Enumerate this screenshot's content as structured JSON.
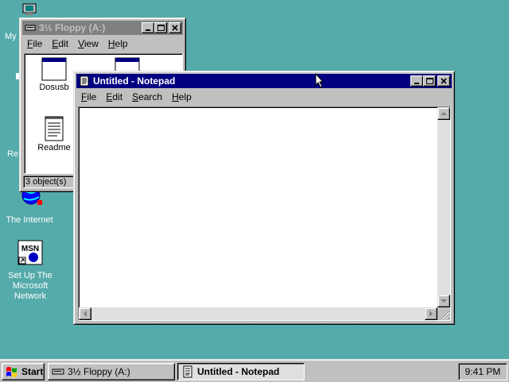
{
  "desktop": {
    "icons": {
      "my_computer_partial": "My",
      "recycle_partial": "Re",
      "internet": "The Internet",
      "msn_line1": "Set Up The",
      "msn_line2": "Microsoft",
      "msn_line3": "Network",
      "msn_badge": "MSN"
    }
  },
  "floppy_window": {
    "title": "3½ Floppy (A:)",
    "menu": [
      "File",
      "Edit",
      "View",
      "Help"
    ],
    "items": [
      "Dosusb",
      "Readme"
    ],
    "status": "3 object(s)"
  },
  "notepad_window": {
    "title": "Untitled - Notepad",
    "menu": [
      "File",
      "Edit",
      "Search",
      "Help"
    ],
    "text": ""
  },
  "taskbar": {
    "start_label": "Start",
    "tasks": [
      "3½ Floppy (A:)",
      "Untitled - Notepad"
    ],
    "clock": "9:41 PM"
  },
  "colors": {
    "desktop": "#55aaaa",
    "active_title": "#000080",
    "inactive_title": "#808080",
    "face": "#c0c0c0"
  }
}
